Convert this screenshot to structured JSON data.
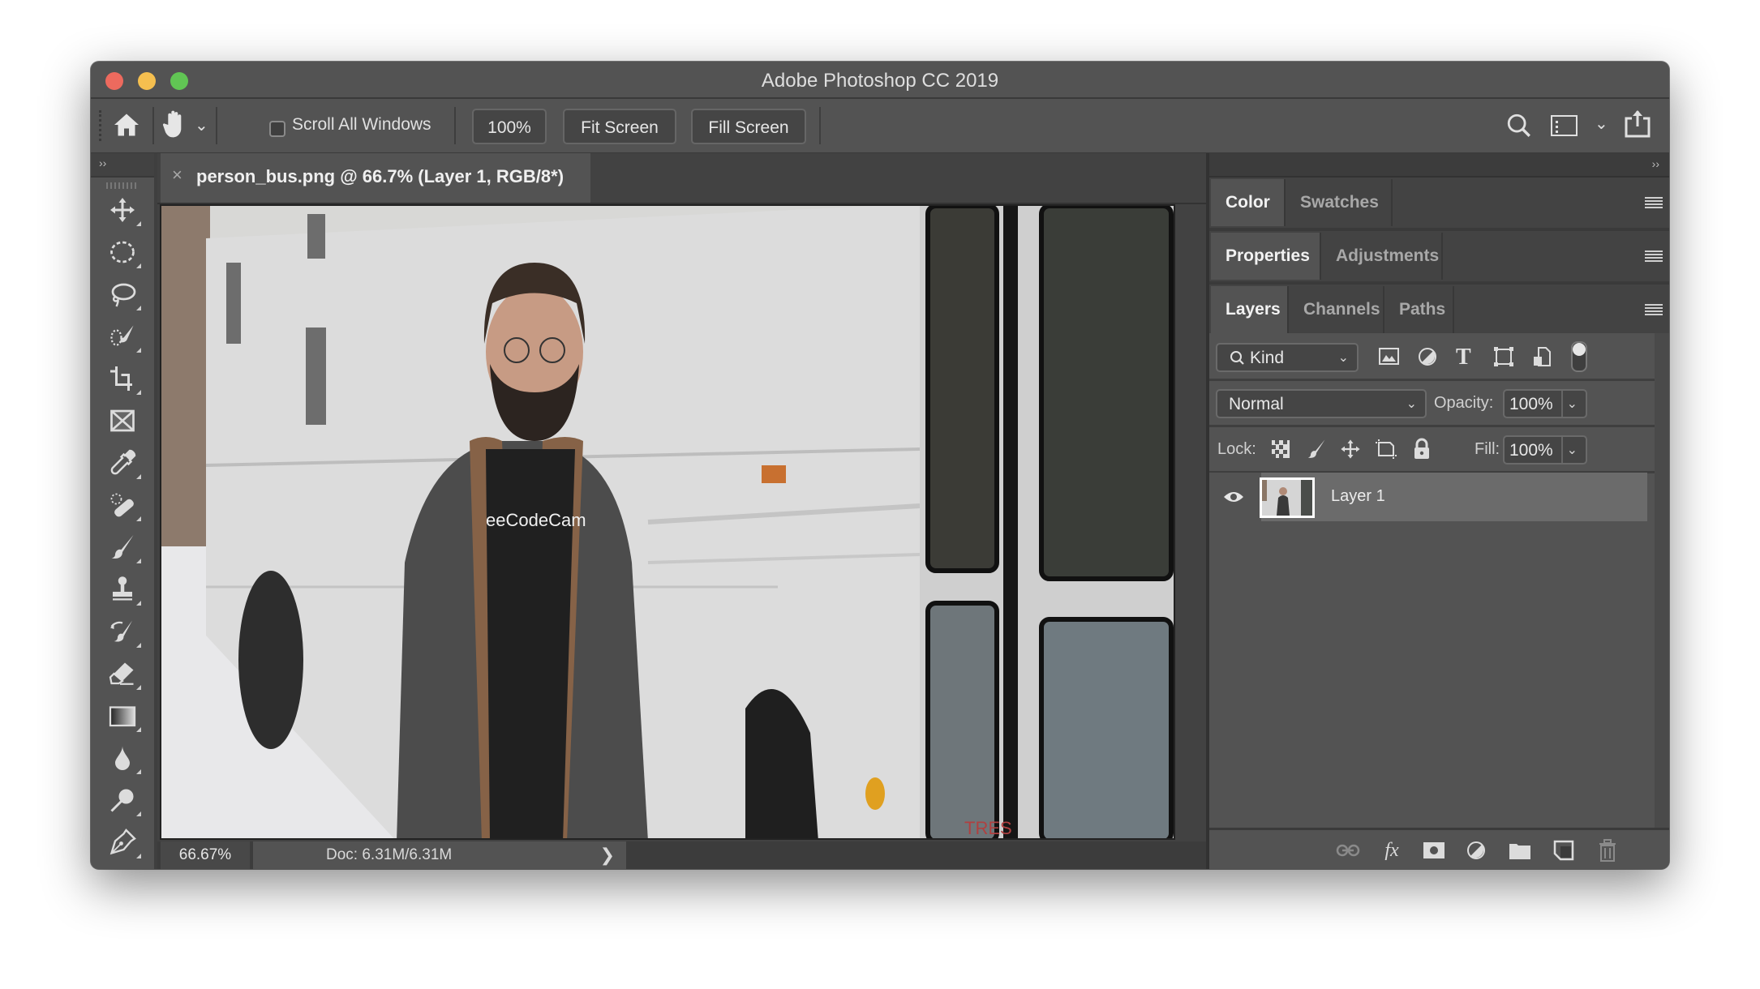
{
  "window": {
    "title": "Adobe Photoshop CC 2019",
    "traffic_lights": {
      "close": "#ed6a5e",
      "minimize": "#f5bf4f",
      "zoom": "#61c554"
    }
  },
  "options_bar": {
    "home_icon": "home-icon",
    "tool_icon": "hand-icon",
    "scroll_all_windows": {
      "label": "Scroll All Windows",
      "checked": false
    },
    "zoom_100_label": "100%",
    "fit_screen_label": "Fit Screen",
    "fill_screen_label": "Fill Screen",
    "right_icons": [
      "search-icon",
      "workspace-icon",
      "share-icon"
    ]
  },
  "tools_panel": {
    "collapse_label": "››",
    "tools": [
      {
        "name": "move-tool",
        "icon": "move-icon"
      },
      {
        "name": "elliptical-marquee-tool",
        "icon": "marquee-icon"
      },
      {
        "name": "lasso-tool",
        "icon": "lasso-icon"
      },
      {
        "name": "quick-selection-tool",
        "icon": "quick-selection-icon"
      },
      {
        "name": "crop-tool",
        "icon": "crop-icon"
      },
      {
        "name": "frame-tool",
        "icon": "frame-icon"
      },
      {
        "name": "eyedropper-tool",
        "icon": "eyedropper-icon"
      },
      {
        "name": "spot-healing-tool",
        "icon": "healing-icon"
      },
      {
        "name": "brush-tool",
        "icon": "brush-icon"
      },
      {
        "name": "clone-stamp-tool",
        "icon": "stamp-icon"
      },
      {
        "name": "history-brush-tool",
        "icon": "history-brush-icon"
      },
      {
        "name": "eraser-tool",
        "icon": "eraser-icon"
      },
      {
        "name": "gradient-tool",
        "icon": "gradient-icon"
      },
      {
        "name": "blur-tool",
        "icon": "blur-icon"
      },
      {
        "name": "dodge-tool",
        "icon": "dodge-icon"
      },
      {
        "name": "pen-tool",
        "icon": "pen-icon"
      }
    ]
  },
  "document": {
    "tab_close": "×",
    "tab_title": "person_bus.png @ 66.7% (Layer 1, RGB/8*)",
    "image_text": "eeCodeCam",
    "sign_text": "TRES"
  },
  "status_bar": {
    "zoom": "66.67%",
    "doc_info": "Doc: 6.31M/6.31M",
    "arrow": "❯"
  },
  "panels": {
    "collapse_label": "››",
    "group1": {
      "tabs": [
        "Color",
        "Swatches"
      ],
      "active": 0
    },
    "group2": {
      "tabs": [
        "Properties",
        "Adjustments"
      ],
      "active": 0
    },
    "group3": {
      "tabs": [
        "Layers",
        "Channels",
        "Paths"
      ],
      "active": 0
    },
    "layers": {
      "filter_kind": "Kind",
      "blend_mode": "Normal",
      "opacity_label": "Opacity:",
      "opacity_value": "100%",
      "lock_label": "Lock:",
      "fill_label": "Fill:",
      "fill_value": "100%",
      "items": [
        {
          "name": "Layer 1",
          "visible": true,
          "selected": true
        }
      ],
      "bottom_icons": [
        "link-layers-icon",
        "fx-icon",
        "add-mask-icon",
        "adjustment-layer-icon",
        "new-group-icon",
        "new-layer-icon",
        "delete-icon"
      ],
      "fx_label": "fx"
    }
  }
}
